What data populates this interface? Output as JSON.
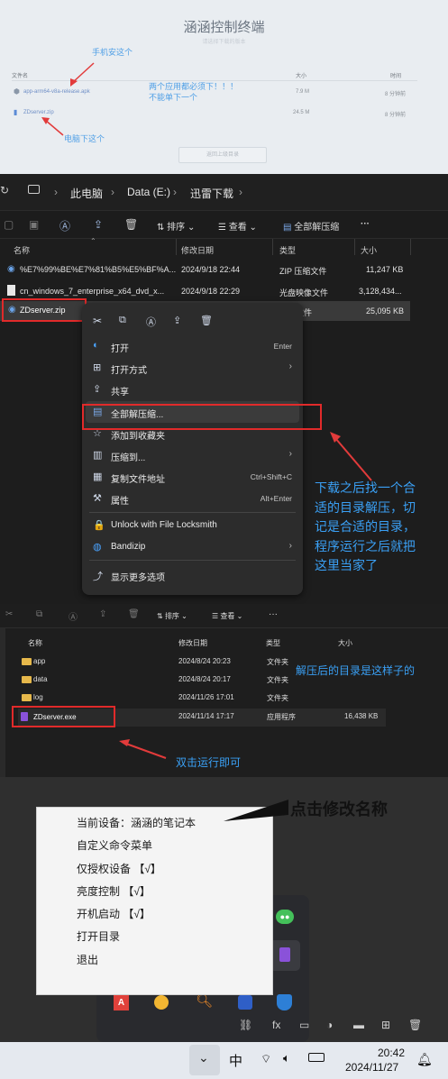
{
  "panel1": {
    "title": "涵涵控制终端",
    "subtitle": "请选择下载的版本",
    "col_name": "文件名",
    "col_size": "大小",
    "col_time": "时间",
    "files": [
      {
        "name": "app-arm64-v8a-release.apk",
        "size": "7.9 M",
        "time": "8 分钟前"
      },
      {
        "name": "ZDserver.zip",
        "size": "24.5 M",
        "time": "8 分钟前"
      }
    ],
    "note_phone": "手机安这个",
    "note_required": "两个应用都必须下！！！\n不能单下一个",
    "note_pc": "电脑下这个",
    "button": "返回上级目录"
  },
  "panel2": {
    "breadcrumb": [
      "此电脑",
      "Data (E:)",
      "迅雷下载"
    ],
    "toolbar": {
      "sort": "排序",
      "view": "查看",
      "extract_all": "全部解压缩",
      "more": "···"
    },
    "columns": {
      "name": "名称",
      "modified": "修改日期",
      "type": "类型",
      "size": "大小"
    },
    "rows": [
      {
        "name": "%E7%99%BE%E7%81%B5%E5%BF%A...",
        "date": "2024/9/18 22:44",
        "type": "ZIP 压缩文件",
        "size": "11,247 KB"
      },
      {
        "name": "cn_windows_7_enterprise_x64_dvd_x...",
        "date": "2024/9/18 22:29",
        "type": "光盘映像文件",
        "size": "3,128,434..."
      },
      {
        "name": "ZDserver.zip",
        "date": "",
        "type": "压缩文件",
        "size": "25,095 KB"
      }
    ],
    "context_menu": [
      {
        "label": "打开",
        "shortcut": "Enter",
        "icon": "edge-icon"
      },
      {
        "label": "打开方式",
        "arrow": "›",
        "icon": "open-with-icon"
      },
      {
        "label": "共享",
        "icon": "share-icon"
      },
      {
        "label": "全部解压缩...",
        "icon": "extract-icon"
      },
      {
        "label": "添加到收藏夹",
        "icon": "star-icon"
      },
      {
        "label": "压缩到...",
        "arrow": "›",
        "icon": "zip-icon"
      },
      {
        "label": "复制文件地址",
        "shortcut": "Ctrl+Shift+C",
        "icon": "copy-path-icon"
      },
      {
        "label": "属性",
        "shortcut": "Alt+Enter",
        "icon": "wrench-icon"
      },
      {
        "label": "Unlock with File Locksmith",
        "icon": "lock-icon"
      },
      {
        "label": "Bandizip",
        "arrow": "›",
        "icon": "bandizip-icon"
      },
      {
        "label": "显示更多选项",
        "icon": "more-options-icon"
      }
    ],
    "note": "下载之后找一个合\n适的目录解压，切\n记是合适的目录，\n程序运行之后就把\n这里当家了"
  },
  "panel3": {
    "toolbar": {
      "sort": "排序",
      "view": "查看"
    },
    "columns": {
      "name": "名称",
      "modified": "修改日期",
      "type": "类型",
      "size": "大小"
    },
    "rows": [
      {
        "name": "app",
        "date": "2024/8/24 20:23",
        "type": "文件夹",
        "size": ""
      },
      {
        "name": "data",
        "date": "2024/8/24 20:17",
        "type": "文件夹",
        "size": ""
      },
      {
        "name": "log",
        "date": "2024/11/26 17:01",
        "type": "文件夹",
        "size": ""
      },
      {
        "name": "ZDserver.exe",
        "date": "2024/11/14 17:17",
        "type": "应用程序",
        "size": "16,438 KB"
      }
    ],
    "note_dir": "解压后的目录是这样子的",
    "note_run": "双击运行即可"
  },
  "panel4": {
    "menu": [
      "当前设备：涵涵的笔记本",
      "自定义命令菜单",
      "仅授权设备 【√】",
      "亮度控制 【√】",
      "开机启动 【√】",
      "打开目录",
      "退出"
    ],
    "note": "点击修改名称",
    "taskbar": {
      "ime": "中",
      "time": "20:42",
      "date": "2024/11/27"
    }
  }
}
